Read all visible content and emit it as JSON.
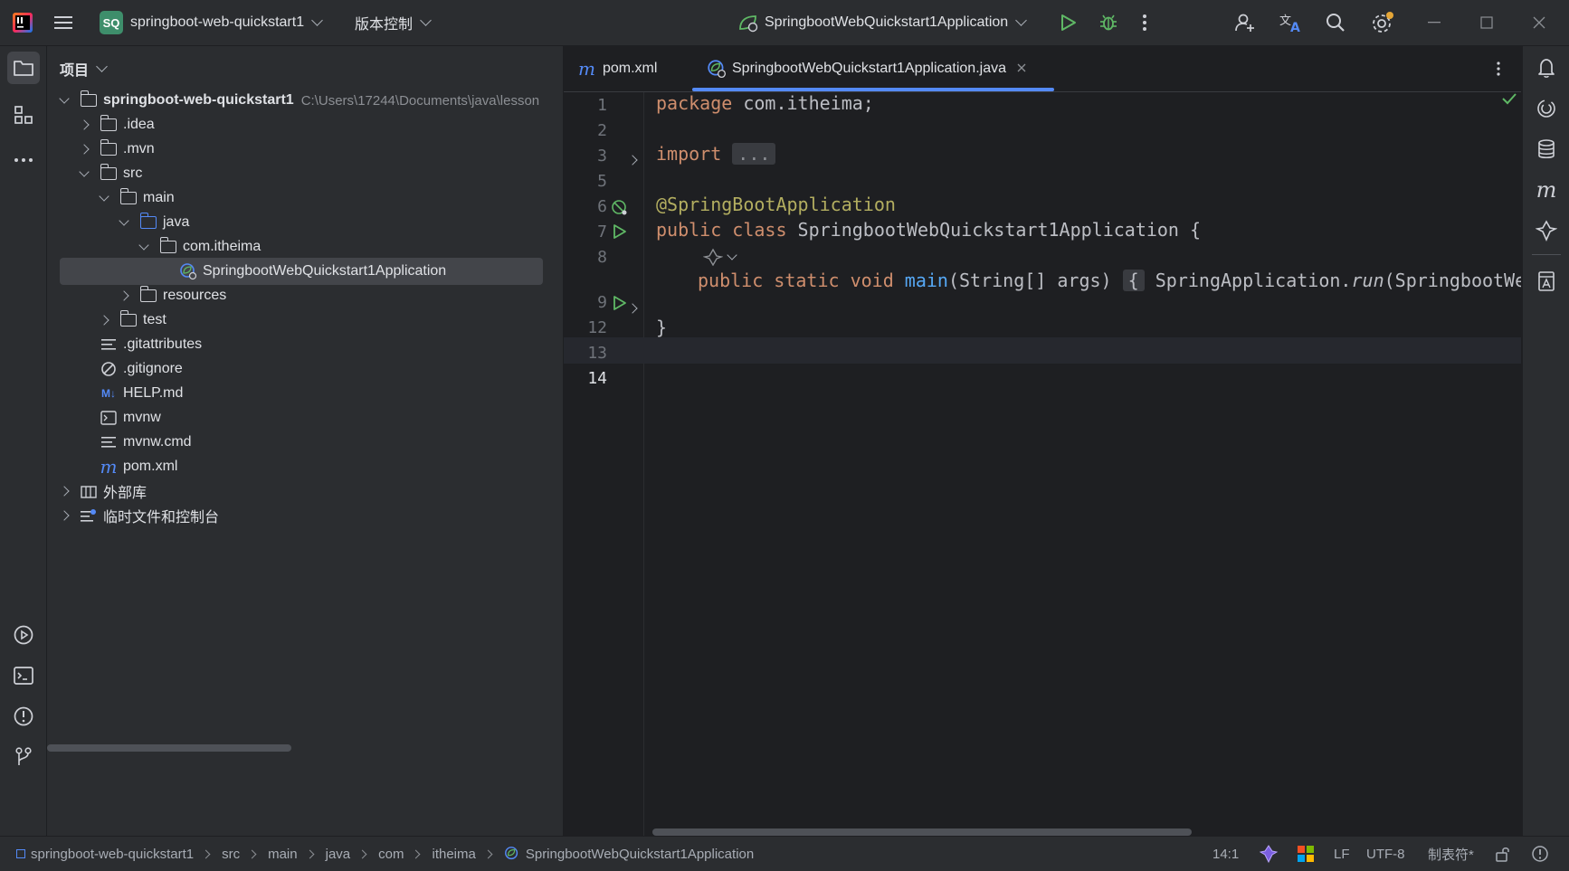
{
  "titlebar": {
    "project_badge": "SQ",
    "project_name": "springboot-web-quickstart1",
    "vcs_menu": "版本控制",
    "run_config": "SpringbootWebQuickstart1Application"
  },
  "project_panel": {
    "title": "项目",
    "root_name": "springboot-web-quickstart1",
    "root_path": "C:\\Users\\17244\\Documents\\java\\lesson",
    "items": [
      {
        "label": ".idea"
      },
      {
        "label": ".mvn"
      },
      {
        "label": "src"
      },
      {
        "label": "main"
      },
      {
        "label": "java"
      },
      {
        "label": "com.itheima"
      },
      {
        "label": "SpringbootWebQuickstart1Application"
      },
      {
        "label": "resources"
      },
      {
        "label": "test"
      },
      {
        "label": ".gitattributes"
      },
      {
        "label": ".gitignore"
      },
      {
        "label": "HELP.md"
      },
      {
        "label": "mvnw"
      },
      {
        "label": "mvnw.cmd"
      },
      {
        "label": "pom.xml"
      },
      {
        "label": "外部库"
      },
      {
        "label": "临时文件和控制台"
      }
    ],
    "md_badge": "M↓",
    "maven_badge": "m"
  },
  "tabs": [
    {
      "label": "pom.xml",
      "icon_letter": "m"
    },
    {
      "label": "SpringbootWebQuickstart1Application.java"
    }
  ],
  "editor": {
    "line_numbers": [
      "1",
      "2",
      "3",
      "5",
      "6",
      "7",
      "8",
      "9",
      "12",
      "13",
      "14"
    ],
    "code": {
      "l1_kw": "package",
      "l1_rest": " com.itheima;",
      "l3_kw": "import",
      "l3_fold": "...",
      "l6_ann": "@SpringBootApplication",
      "l7_kw": "public class",
      "l7_rest": " SpringbootWebQuickstart1Application {",
      "l9_kw": "public static void",
      "l9_fn": "main",
      "l9_args": "(String[] args)",
      "l9_brace": "{",
      "l9_body_a": "SpringApplication.",
      "l9_body_run": "run",
      "l9_body_b": "(SpringbootWebQ",
      "l13": "}"
    }
  },
  "statusbar": {
    "breadcrumbs": [
      "springboot-web-quickstart1",
      "src",
      "main",
      "java",
      "com",
      "itheima",
      "SpringbootWebQuickstart1Application"
    ],
    "position": "14:1",
    "line_sep": "LF",
    "encoding": "UTF-8",
    "indent": "制表符*"
  },
  "colors": {
    "accent": "#548af7",
    "run_green": "#5fb865",
    "keyword": "#cf8e6d",
    "annotation": "#b3ae60",
    "function": "#56a8f5"
  }
}
